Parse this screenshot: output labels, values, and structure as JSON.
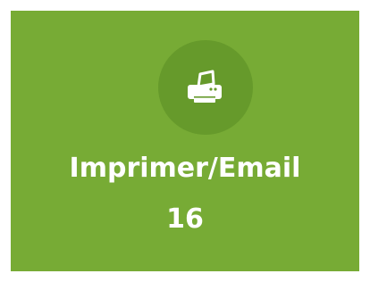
{
  "tile": {
    "title": "Imprimer/Email",
    "count": "16",
    "icon": "printer-icon",
    "background_color": "#77ab35",
    "icon_circle_color": "#669a2b",
    "text_color": "#ffffff"
  }
}
